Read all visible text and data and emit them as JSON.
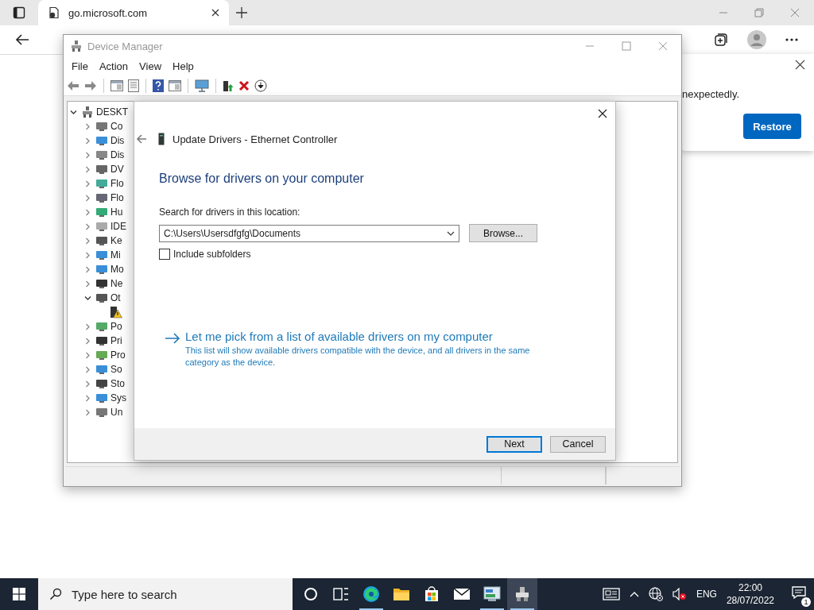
{
  "browser": {
    "tab": {
      "title": "go.microsoft.com"
    }
  },
  "restore_popup": {
    "message": "nexpectedly.",
    "button": "Restore"
  },
  "device_manager": {
    "title": "Device Manager",
    "menu": [
      "File",
      "Action",
      "View",
      "Help"
    ],
    "tree": [
      {
        "label": "DESKT",
        "kind": "computer",
        "expanded": true,
        "children": [
          {
            "label": "Co",
            "kind": "category",
            "expanded": false
          },
          {
            "label": "Dis",
            "kind": "category",
            "expanded": false
          },
          {
            "label": "Dis",
            "kind": "category",
            "expanded": false
          },
          {
            "label": "DV",
            "kind": "category",
            "expanded": false
          },
          {
            "label": "Flo",
            "kind": "category",
            "expanded": false
          },
          {
            "label": "Flo",
            "kind": "category",
            "expanded": false
          },
          {
            "label": "Hu",
            "kind": "category",
            "expanded": false
          },
          {
            "label": "IDE",
            "kind": "category",
            "expanded": false
          },
          {
            "label": "Ke",
            "kind": "category",
            "expanded": false
          },
          {
            "label": "Mi",
            "kind": "category",
            "expanded": false
          },
          {
            "label": "Mo",
            "kind": "category",
            "expanded": false
          },
          {
            "label": "Ne",
            "kind": "category",
            "expanded": false
          },
          {
            "label": "Ot",
            "kind": "category",
            "expanded": true,
            "children": [
              {
                "kind": "warning-device"
              }
            ]
          },
          {
            "label": "Po",
            "kind": "category",
            "expanded": false
          },
          {
            "label": "Pri",
            "kind": "category",
            "expanded": false
          },
          {
            "label": "Pro",
            "kind": "category",
            "expanded": false
          },
          {
            "label": "So",
            "kind": "category",
            "expanded": false
          },
          {
            "label": "Sto",
            "kind": "category",
            "expanded": false
          },
          {
            "label": "Sys",
            "kind": "category",
            "expanded": false
          },
          {
            "label": "Un",
            "kind": "category",
            "expanded": false
          }
        ]
      }
    ]
  },
  "dialog": {
    "title": "Update Drivers - Ethernet Controller",
    "heading": "Browse for drivers on your computer",
    "location_label": "Search for drivers in this location:",
    "path": {
      "value": "C:\\Users\\Usersdfgfg\\Documents"
    },
    "include_subfolders": {
      "label": "Include subfolders",
      "checked": false
    },
    "browse_button": "Browse...",
    "pick_link": {
      "title": "Let me pick from a list of available drivers on my computer",
      "description": "This list will show available drivers compatible with the device, and all drivers in the same category as the device."
    },
    "buttons": [
      {
        "label": "Next",
        "default": true
      },
      {
        "label": "Cancel",
        "default": false
      }
    ]
  },
  "taskbar": {
    "search": {
      "placeholder": "Type here to search"
    },
    "apps": [
      {
        "kind": "cortana",
        "running": false,
        "active": false
      },
      {
        "kind": "task-view",
        "running": false,
        "active": false
      },
      {
        "kind": "edge",
        "running": true,
        "active": false
      },
      {
        "kind": "explorer",
        "running": false,
        "active": false
      },
      {
        "kind": "store",
        "running": false,
        "active": false
      },
      {
        "kind": "mail",
        "running": false,
        "active": false
      },
      {
        "kind": "control-panel",
        "running": true,
        "active": false
      },
      {
        "kind": "device-manager",
        "running": true,
        "active": true
      }
    ],
    "language": "ENG",
    "time": "22:00",
    "date": "28/07/2022",
    "notification_count": "1"
  }
}
